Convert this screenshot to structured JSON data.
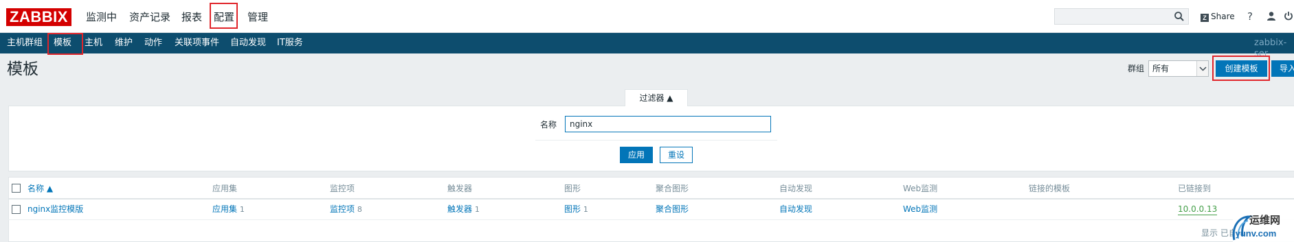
{
  "brand": {
    "logo": "ZABBIX",
    "accent": "#d40000"
  },
  "top_nav": [
    {
      "label": "监测中"
    },
    {
      "label": "资产记录"
    },
    {
      "label": "报表"
    },
    {
      "label": "配置"
    },
    {
      "label": "管理"
    }
  ],
  "top_right": {
    "search_value": "",
    "share_label": "Share",
    "help_icon": "help-icon",
    "user_icon": "user-icon",
    "power_icon": "power-icon"
  },
  "sub_nav": [
    {
      "label": "主机群组"
    },
    {
      "label": "模板"
    },
    {
      "label": "主机"
    },
    {
      "label": "维护"
    },
    {
      "label": "动作"
    },
    {
      "label": "关联项事件"
    },
    {
      "label": "自动发现"
    },
    {
      "label": "IT服务"
    }
  ],
  "server_name": "zabbix-ser",
  "page": {
    "title": "模板",
    "group_label": "群组",
    "group_value": "所有",
    "create_label": "创建模板",
    "import_label": "导入"
  },
  "filter": {
    "tab_label": "过滤器 ▲",
    "name_label": "名称",
    "name_value": "nginx",
    "apply_label": "应用",
    "reset_label": "重设"
  },
  "table": {
    "headers": {
      "name": "名称 ▲",
      "applications": "应用集",
      "items": "监控项",
      "triggers": "触发器",
      "graphs": "图形",
      "screens": "聚合图形",
      "discovery": "自动发现",
      "web": "Web监测",
      "linked_templates": "链接的模板",
      "linked_to": "已链接到"
    },
    "rows": [
      {
        "name": "nginx监控模版",
        "applications": "应用集",
        "applications_count": "1",
        "items": "监控项",
        "items_count": "8",
        "triggers": "触发器",
        "triggers_count": "1",
        "graphs": "图形",
        "graphs_count": "1",
        "screens": "聚合图形",
        "discovery": "自动发现",
        "web": "Web监测",
        "linked_to": "10.0.0.13"
      }
    ],
    "paging_text": "显示 已自动发"
  },
  "watermark": {
    "text": "运维网",
    "url": "iyunv.com"
  },
  "colors": {
    "subnav_bg": "#0d4d6e",
    "link": "#0275b8",
    "button": "#0275b8",
    "highlight": "#e0242a",
    "linked_green": "#429e47"
  }
}
